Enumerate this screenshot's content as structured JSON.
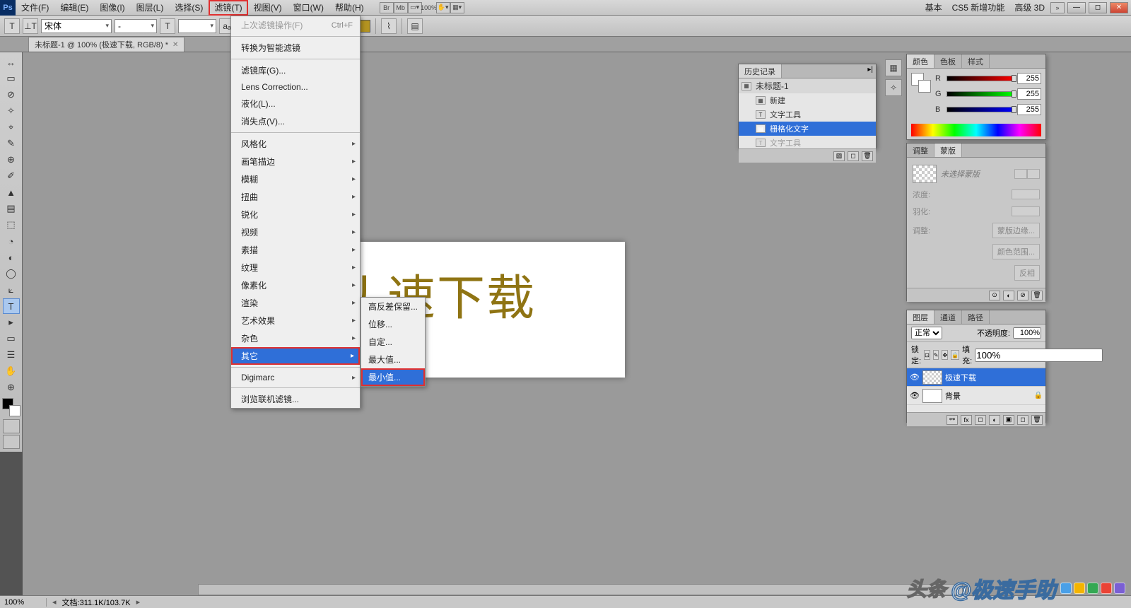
{
  "app": {
    "logo": "Ps"
  },
  "menu": {
    "items": [
      "文件(F)",
      "编辑(E)",
      "图像(I)",
      "图层(L)",
      "选择(S)",
      "滤镜(T)",
      "视图(V)",
      "窗口(W)",
      "帮助(H)"
    ],
    "highlighted_index": 5
  },
  "menubar_right": {
    "zoom": "100%",
    "labels": [
      "基本",
      "CS5 新增功能",
      "高级 3D"
    ]
  },
  "optionsbar": {
    "type_tool": "T",
    "font_family": "宋体",
    "font_style": "-",
    "align_icons": [
      "a",
      "a",
      "a"
    ]
  },
  "document_tab": {
    "title": "未标题-1 @ 100% (极速下载, RGB/8) *"
  },
  "canvas": {
    "text": "丿速下载"
  },
  "filter_menu": {
    "top_item": {
      "label": "上次滤镜操作(F)",
      "shortcut": "Ctrl+F",
      "disabled": true
    },
    "group1": [
      "转换为智能滤镜"
    ],
    "group2": [
      "滤镜库(G)...",
      "Lens Correction...",
      "液化(L)...",
      "消失点(V)..."
    ],
    "submenus": [
      "风格化",
      "画笔描边",
      "模糊",
      "扭曲",
      "锐化",
      "视频",
      "素描",
      "纹理",
      "像素化",
      "渲染",
      "艺术效果",
      "杂色",
      "其它"
    ],
    "highlighted_submenu": "其它",
    "group3": [
      "Digimarc"
    ],
    "group4": [
      "浏览联机滤镜..."
    ]
  },
  "other_submenu": {
    "items": [
      "高反差保留...",
      "位移...",
      "自定...",
      "最大值...",
      "最小值..."
    ],
    "highlighted": "最小值..."
  },
  "history_panel": {
    "tab": "历史记录",
    "doc_name": "未标题-1",
    "entries": [
      {
        "icon": "▦",
        "label": "新建",
        "sel": false,
        "dim": false
      },
      {
        "icon": "T",
        "label": "文字工具",
        "sel": false,
        "dim": false
      },
      {
        "icon": "▤",
        "label": "栅格化文字",
        "sel": true,
        "dim": false
      },
      {
        "icon": "T",
        "label": "文字工具",
        "sel": false,
        "dim": true
      }
    ]
  },
  "color_panel": {
    "tabs": [
      "颜色",
      "色板",
      "样式"
    ],
    "channels": [
      {
        "lbl": "R",
        "val": "255",
        "cls": "r"
      },
      {
        "lbl": "G",
        "val": "255",
        "cls": "g"
      },
      {
        "lbl": "B",
        "val": "255",
        "cls": "b"
      }
    ]
  },
  "masks_panel": {
    "tabs": [
      "调整",
      "蒙版"
    ],
    "no_mask": "未选择蒙版",
    "rows": [
      {
        "label": "浓度:"
      },
      {
        "label": "羽化:"
      }
    ],
    "adjust_label": "调整:",
    "buttons": [
      "蒙版边缘...",
      "颜色范围...",
      "反相"
    ]
  },
  "layers_panel": {
    "tabs": [
      "图层",
      "通道",
      "路径"
    ],
    "blend_mode": "正常",
    "opacity_label": "不透明度:",
    "opacity": "100%",
    "lock_label": "锁定:",
    "fill_label": "填充:",
    "fill": "100%",
    "layers": [
      {
        "name": "极速下载",
        "sel": true,
        "checker": true,
        "lock": false
      },
      {
        "name": "背景",
        "sel": false,
        "checker": false,
        "lock": true
      }
    ]
  },
  "statusbar": {
    "zoom": "100%",
    "doc_info": "文档:311.1K/103.7K"
  },
  "watermark": {
    "pre": "头条",
    "main": "@极速手助"
  },
  "tools": [
    "↔",
    "▭",
    "⊘",
    "✧",
    "⌖",
    "✎",
    "⊕",
    "✐",
    "▲",
    "▤",
    "⬚",
    "◔",
    "▭",
    "✎",
    "⟀",
    "◐",
    "✋",
    "⊙",
    "T",
    "▸",
    "☰",
    "✋",
    "⊕"
  ]
}
